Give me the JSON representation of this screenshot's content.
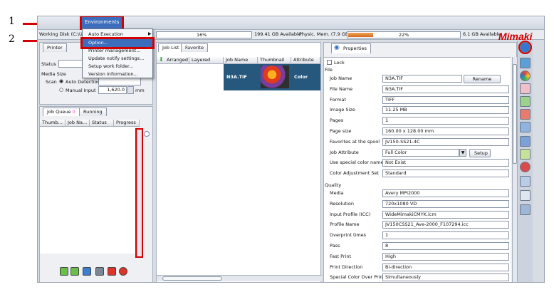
{
  "annotations": {
    "num1": "1",
    "num2": "2",
    "color": "#d40000"
  },
  "menubar": {
    "environments": "Environments"
  },
  "status": {
    "disk": "Working Disk (C:\\User",
    "pct1": "16%",
    "avail1": "199.41 GB Available",
    "phys": "Physic. Mem. (7.9 GB)",
    "pct2": "22%",
    "avail2": "6.1 GB Available",
    "mem_fill": 0.22
  },
  "logo": "Mimaki",
  "dropdown": {
    "items": [
      "Auto Execution",
      "Option...",
      "Printer management...",
      "Update notify settings...",
      "Setup work folder...",
      "Version Information..."
    ]
  },
  "printer_panel": {
    "tab": "Printer",
    "status_label": "Status",
    "media_size_label": "Media Size",
    "scan_label": "Scan",
    "auto_detection": "Auto Detection",
    "manual_input": "Manual Input",
    "manual_value": "1,620.0",
    "unit": "mm"
  },
  "queue": {
    "tab_job_queue": "Job Queue",
    "queue_count": "0",
    "tab_running": "Running",
    "columns": [
      "Thumb...",
      "Job Na...",
      "Status",
      "Progress"
    ]
  },
  "joblist": {
    "tab_job_list": "Job List",
    "tab_favorite": "Favorite",
    "columns": [
      "Arranged",
      "Layered",
      "Job Name",
      "Thumbnail",
      "Attribute"
    ],
    "row": {
      "job_name": "N3A.TIF",
      "attribute": "Color"
    }
  },
  "properties": {
    "tab": "Properties",
    "lock": "Lock",
    "section_file": "File",
    "section_quality": "Quality",
    "rename_button": "Rename",
    "setup_button": "Setup",
    "file_rows": [
      {
        "label": "Job Name",
        "value": "N3A.TIF"
      },
      {
        "label": "File Name",
        "value": "N3A.TIF"
      },
      {
        "label": "Format",
        "value": "TIFF"
      },
      {
        "label": "Image Size",
        "value": "11.25 MB"
      },
      {
        "label": "Pages",
        "value": "1"
      },
      {
        "label": "Page size",
        "value": "160.00 x 128.00 mm"
      },
      {
        "label": "Favorites at the spool",
        "value": "JV150-SS21-4C"
      },
      {
        "label": "Job Attribute",
        "value": "Full Color"
      },
      {
        "label": "Use special color names",
        "value": "Not Exist"
      },
      {
        "label": "Color Adjustment Set",
        "value": "Standard"
      }
    ],
    "quality_rows": [
      {
        "label": "Media",
        "value": "Avery MPI2000"
      },
      {
        "label": "Resolution",
        "value": "720x1080 VD"
      },
      {
        "label": "Input Profile (ICC)",
        "value": "WideMimakiCMYK.icm"
      },
      {
        "label": "Profile Name",
        "value": "JV150CSS21_Ave-2000_F107294.icc"
      },
      {
        "label": "Overprint times",
        "value": "1"
      },
      {
        "label": "Pass",
        "value": "8"
      },
      {
        "label": "Fast Print",
        "value": "High"
      },
      {
        "label": "Print Direction",
        "value": "Bi-direction"
      },
      {
        "label": "Special Color Over Print",
        "value": "Simultaneously"
      }
    ]
  }
}
